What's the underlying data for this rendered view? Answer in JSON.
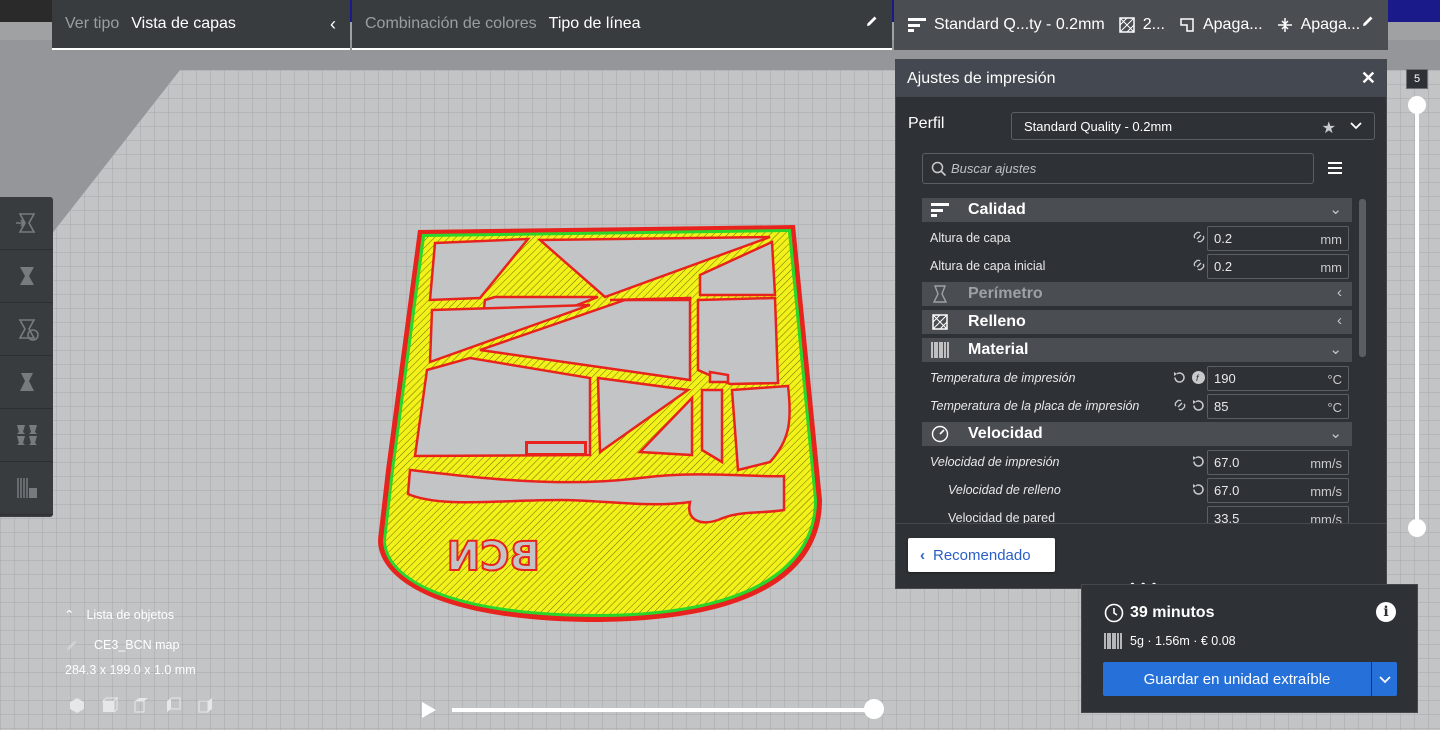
{
  "header": {
    "view_type_label": "Ver tipo",
    "view_type_value": "Vista de capas",
    "color_scheme_label": "Combinación de colores",
    "color_scheme_value": "Tipo de línea",
    "print_setup": {
      "profile": "Standard Q...ty - 0.2mm",
      "infill": "2...",
      "support": "Apaga...",
      "adhesion": "Apaga..."
    }
  },
  "toolbar": {
    "tools": [
      "move-tool-icon",
      "scale-tool-icon",
      "rotate-tool-icon",
      "mirror-tool-icon",
      "per-model-settings-icon",
      "support-blocker-icon"
    ]
  },
  "settings_panel": {
    "title": "Ajustes de impresión",
    "profile_label": "Perfil",
    "profile_value": "Standard Quality - 0.2mm",
    "search_placeholder": "Buscar ajustes",
    "categories": {
      "quality": "Calidad",
      "walls": "Perímetro",
      "infill": "Relleno",
      "material": "Material",
      "speed": "Velocidad"
    },
    "rows": {
      "layer_height": {
        "label": "Altura de capa",
        "value": "0.2",
        "unit": "mm"
      },
      "initial_layer_height": {
        "label": "Altura de capa inicial",
        "value": "0.2",
        "unit": "mm"
      },
      "print_temp": {
        "label": "Temperatura de impresión",
        "value": "190",
        "unit": "°C"
      },
      "bed_temp": {
        "label": "Temperatura de la placa de impresión",
        "value": "85",
        "unit": "°C"
      },
      "print_speed": {
        "label": "Velocidad de impresión",
        "value": "67.0",
        "unit": "mm/s"
      },
      "infill_speed": {
        "label": "Velocidad de relleno",
        "value": "67.0",
        "unit": "mm/s"
      },
      "wall_speed": {
        "label": "Velocidad de pared",
        "value": "33.5",
        "unit": "mm/s"
      }
    },
    "recommended_button": "Recomendado"
  },
  "output": {
    "time": "39 minutos",
    "material": "5g · 1.56m · € 0.08",
    "save_button": "Guardar en unidad extraíble"
  },
  "layer_slider": {
    "value": "5"
  },
  "object_list": {
    "header": "Lista de objetos",
    "object_name": "CE3_BCN map",
    "dimensions": "284.3 x 199.0 x 1.0 mm"
  },
  "model_text": "BCN",
  "colors": {
    "infill": "#f2f21a",
    "outer_wall": "#e8231e",
    "inner_wall": "#2bd62b",
    "accent": "#2670d9"
  }
}
